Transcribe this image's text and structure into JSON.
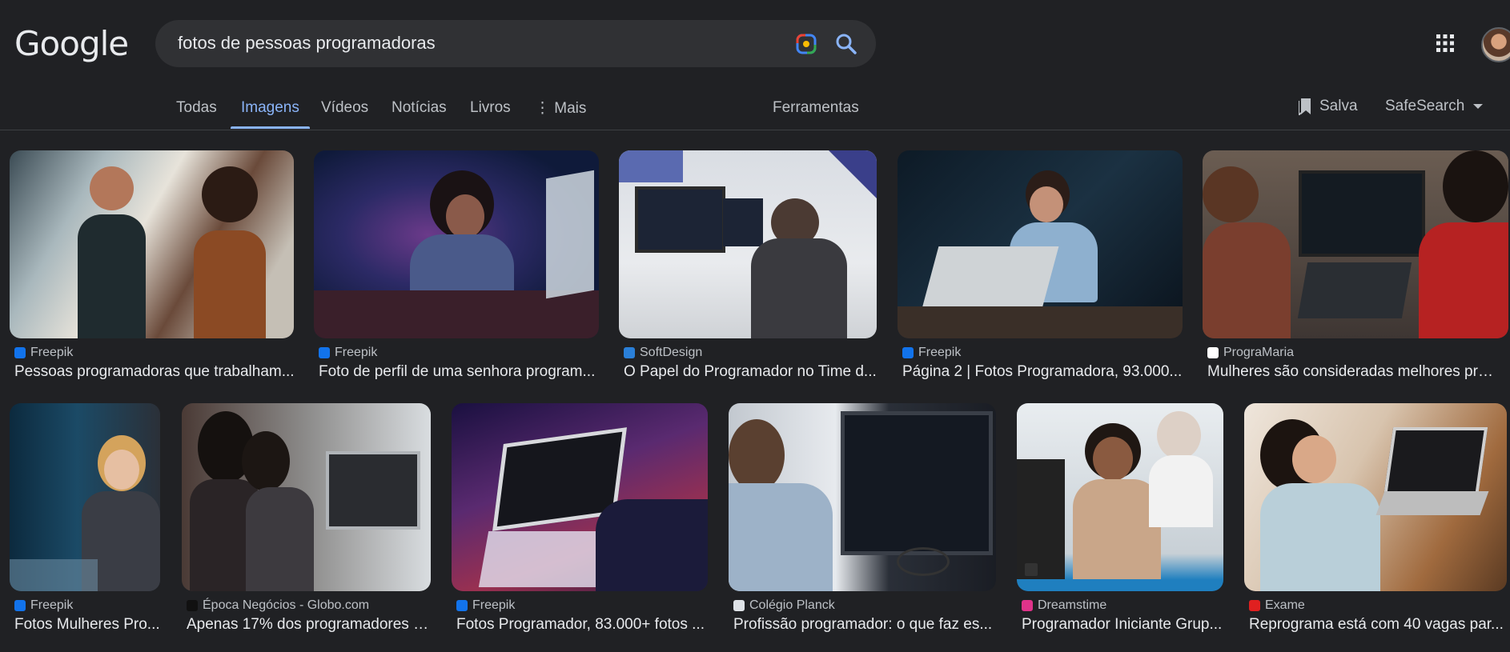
{
  "header": {
    "logo": "Google",
    "search_value": "fotos de pessoas programadoras"
  },
  "tabs": [
    {
      "label": "Todas"
    },
    {
      "label": "Imagens"
    },
    {
      "label": "Vídeos"
    },
    {
      "label": "Notícias"
    },
    {
      "label": "Livros"
    },
    {
      "label": "⋮ Mais"
    }
  ],
  "tools_label": "Ferramentas",
  "saved_label": "Salva",
  "safesearch_label": "SafeSearch",
  "results": [
    {
      "source": "Freepik",
      "title": "Pessoas programadoras que trabalham..."
    },
    {
      "source": "Freepik",
      "title": "Foto de perfil de uma senhora program..."
    },
    {
      "source": "SoftDesign",
      "title": "O Papel do Programador no Time d..."
    },
    {
      "source": "Freepik",
      "title": "Página 2 | Fotos Programadora, 93.000..."
    },
    {
      "source": "PrograMaria",
      "title": "Mulheres são consideradas melhores pro..."
    },
    {
      "source": "Freepik",
      "title": "Fotos Mulheres Pro..."
    },
    {
      "source": "Época Negócios - Globo.com",
      "title": "Apenas 17% dos programadores b..."
    },
    {
      "source": "Freepik",
      "title": "Fotos Programador, 83.000+ fotos ..."
    },
    {
      "source": "Colégio Planck",
      "title": "Profissão programador: o que faz es..."
    },
    {
      "source": "Dreamstime",
      "title": "Programador Iniciante Grup..."
    },
    {
      "source": "Exame",
      "title": "Reprograma está com 40 vagas par..."
    }
  ],
  "colors": {
    "accent": "#8ab4f8",
    "background": "#202124",
    "search_bg": "#303134"
  }
}
